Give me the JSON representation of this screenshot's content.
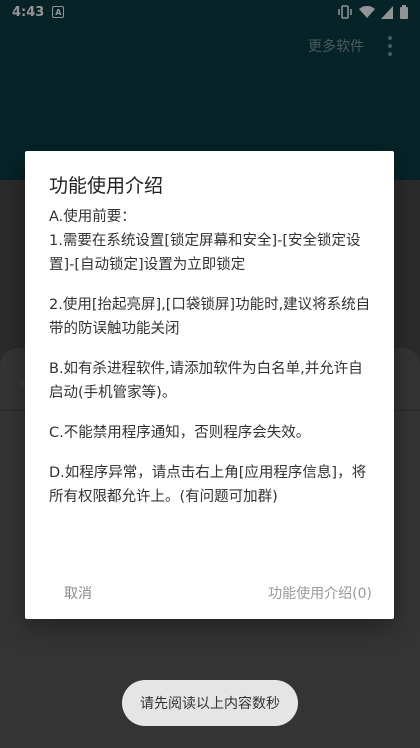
{
  "status_bar": {
    "time": "4:43",
    "app_icon_letter": "A",
    "icons": [
      "vibrate-icon",
      "wifi-icon",
      "signal-icon",
      "battery-icon"
    ]
  },
  "toolbar": {
    "more_software": "更多软件",
    "overflow_icon": "more-vert-icon"
  },
  "dialog": {
    "title": "功能使用介绍",
    "paragraphs": [
      "A.使用前要：",
      "1.需要在系统设置[锁定屏幕和安全]-[安全锁定设置]-[自动锁定]设置为立即锁定",
      "2.使用[抬起亮屏],[口袋锁屏]功能时,建议将系统自带的防误触功能关闭",
      "B.如有杀进程软件,请添加软件为白名单,并允许自启动(手机管家等)。",
      "C.不能禁用程序通知，否则程序会失效。",
      "D.如程序异常，请点击右上角[应用程序信息]，将所有权限都允许上。(有问题可加群)"
    ],
    "cancel_label": "取消",
    "intro_label": "功能使用介绍(0)"
  },
  "toast": {
    "message": "请先阅读以上内容数秒"
  },
  "colors": {
    "app_bar": "#0b3d45",
    "dialog_bg": "#ffffff",
    "toast_bg": "#e5e5e5"
  }
}
